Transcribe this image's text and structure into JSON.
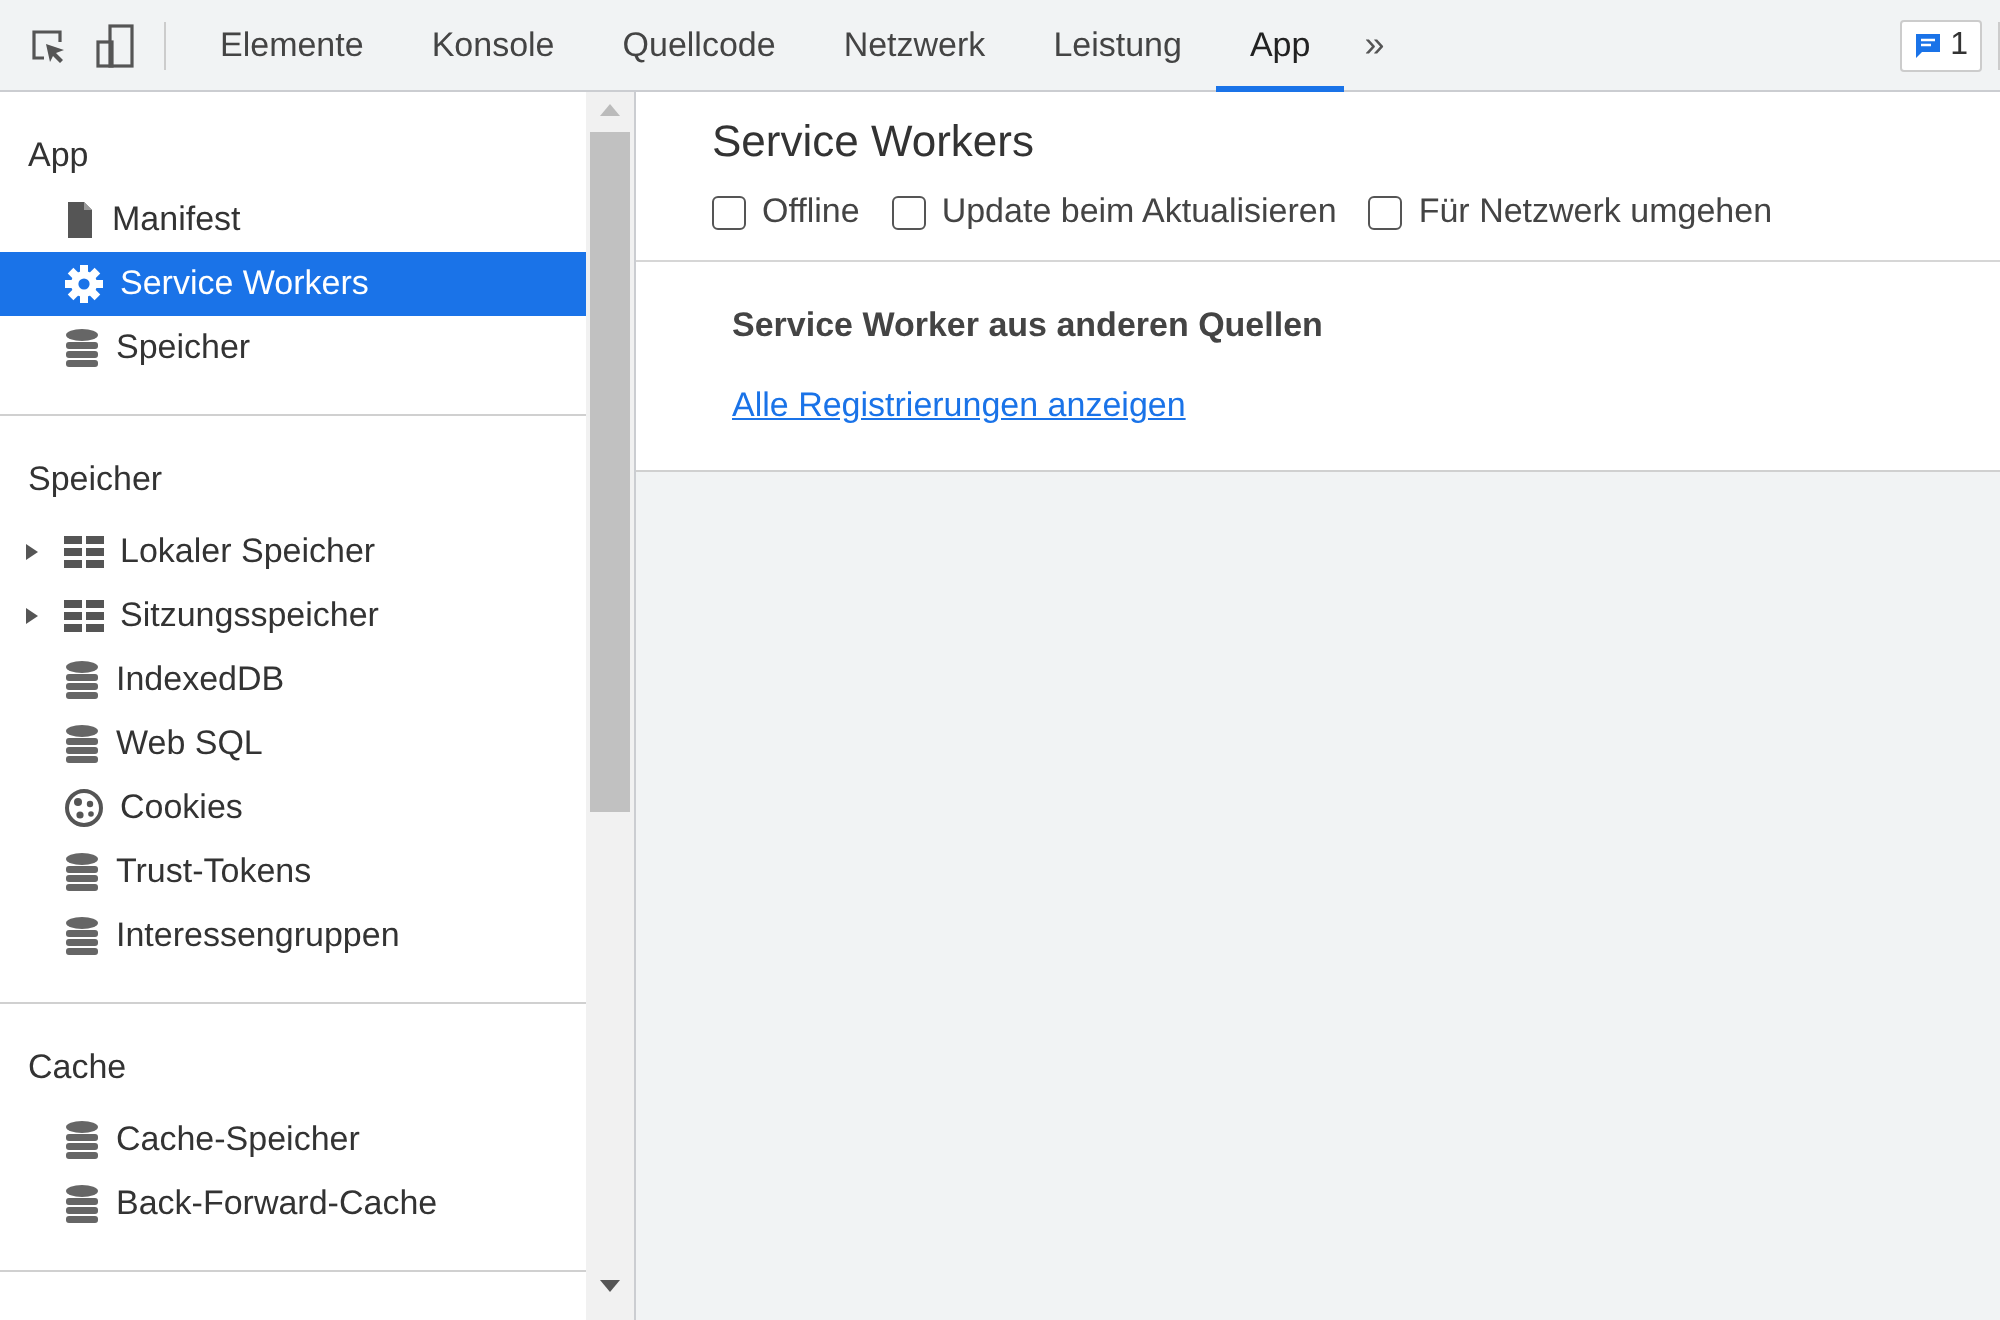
{
  "toolbar": {
    "tabs": [
      {
        "label": "Elemente",
        "selected": false
      },
      {
        "label": "Konsole",
        "selected": false
      },
      {
        "label": "Quellcode",
        "selected": false
      },
      {
        "label": "Netzwerk",
        "selected": false
      },
      {
        "label": "Leistung",
        "selected": false
      },
      {
        "label": "App",
        "selected": true
      }
    ],
    "more": "»",
    "issues_count": "1"
  },
  "sidebar": {
    "sections": [
      {
        "title": "App",
        "items": [
          {
            "label": "Manifest",
            "kind": "file",
            "selected": false
          },
          {
            "label": "Service Workers",
            "kind": "gear",
            "selected": true
          },
          {
            "label": "Speicher",
            "kind": "database",
            "selected": false
          }
        ]
      },
      {
        "title": "Speicher",
        "items": [
          {
            "label": "Lokaler Speicher",
            "kind": "grid",
            "expanded": false,
            "selected": false
          },
          {
            "label": "Sitzungsspeicher",
            "kind": "grid",
            "expanded": false,
            "selected": false
          },
          {
            "label": "IndexedDB",
            "kind": "database",
            "selected": false
          },
          {
            "label": "Web SQL",
            "kind": "database",
            "selected": false
          },
          {
            "label": "Cookies",
            "kind": "cookie",
            "selected": false
          },
          {
            "label": "Trust-Tokens",
            "kind": "database",
            "selected": false
          },
          {
            "label": "Interessengruppen",
            "kind": "database",
            "selected": false
          }
        ]
      },
      {
        "title": "Cache",
        "items": [
          {
            "label": "Cache-Speicher",
            "kind": "database",
            "selected": false
          },
          {
            "label": "Back-Forward-Cache",
            "kind": "database",
            "selected": false
          }
        ]
      }
    ]
  },
  "main": {
    "title": "Service Workers",
    "options": [
      {
        "label": "Offline",
        "checked": false
      },
      {
        "label": "Update beim Aktualisieren",
        "checked": false
      },
      {
        "label": "Für Netzwerk umgehen",
        "checked": false
      }
    ],
    "other_origins": {
      "heading": "Service Worker aus anderen Quellen",
      "link": "Alle Registrierungen anzeigen"
    }
  }
}
